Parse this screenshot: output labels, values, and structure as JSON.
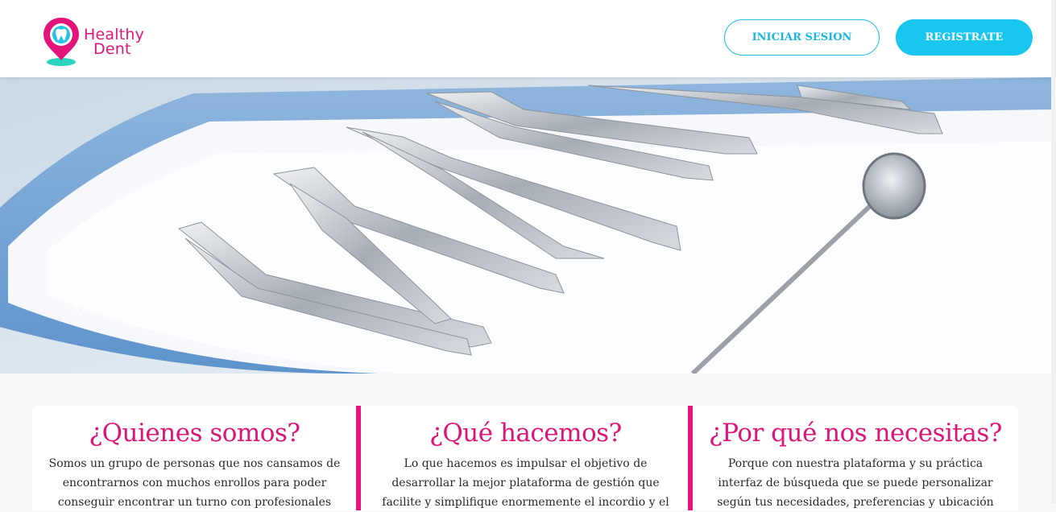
{
  "header": {
    "logo": {
      "line1": "Healthy",
      "line2": "Dent"
    },
    "login_label": "INICIAR SESION",
    "register_label": "REGISTRATE"
  },
  "carousel": {
    "prev_icon": "chevron-left-icon",
    "next_icon": "chevron-right-icon"
  },
  "sections": [
    {
      "title": "¿Quienes somos?",
      "text": "Somos un grupo de personas que nos cansamos de encontrarnos con muchos enrollos para poder conseguir encontrar un turno con profesionales"
    },
    {
      "title": "¿Qué hacemos?",
      "text": "Lo que hacemos es impulsar el objetivo de desarrollar la mejor plataforma de gestión que facilite y simplifique enormemente el incordio y el"
    },
    {
      "title": "¿Por qué nos necesitas?",
      "text": "Porque con nuestra plataforma y su práctica interfaz de búsqueda que se puede personalizar según tus necesidades, preferencias y ubicación"
    }
  ],
  "colors": {
    "brand_pink": "#e4157a",
    "brand_cyan": "#18c6ee",
    "brand_teal": "#2bd3c0"
  }
}
